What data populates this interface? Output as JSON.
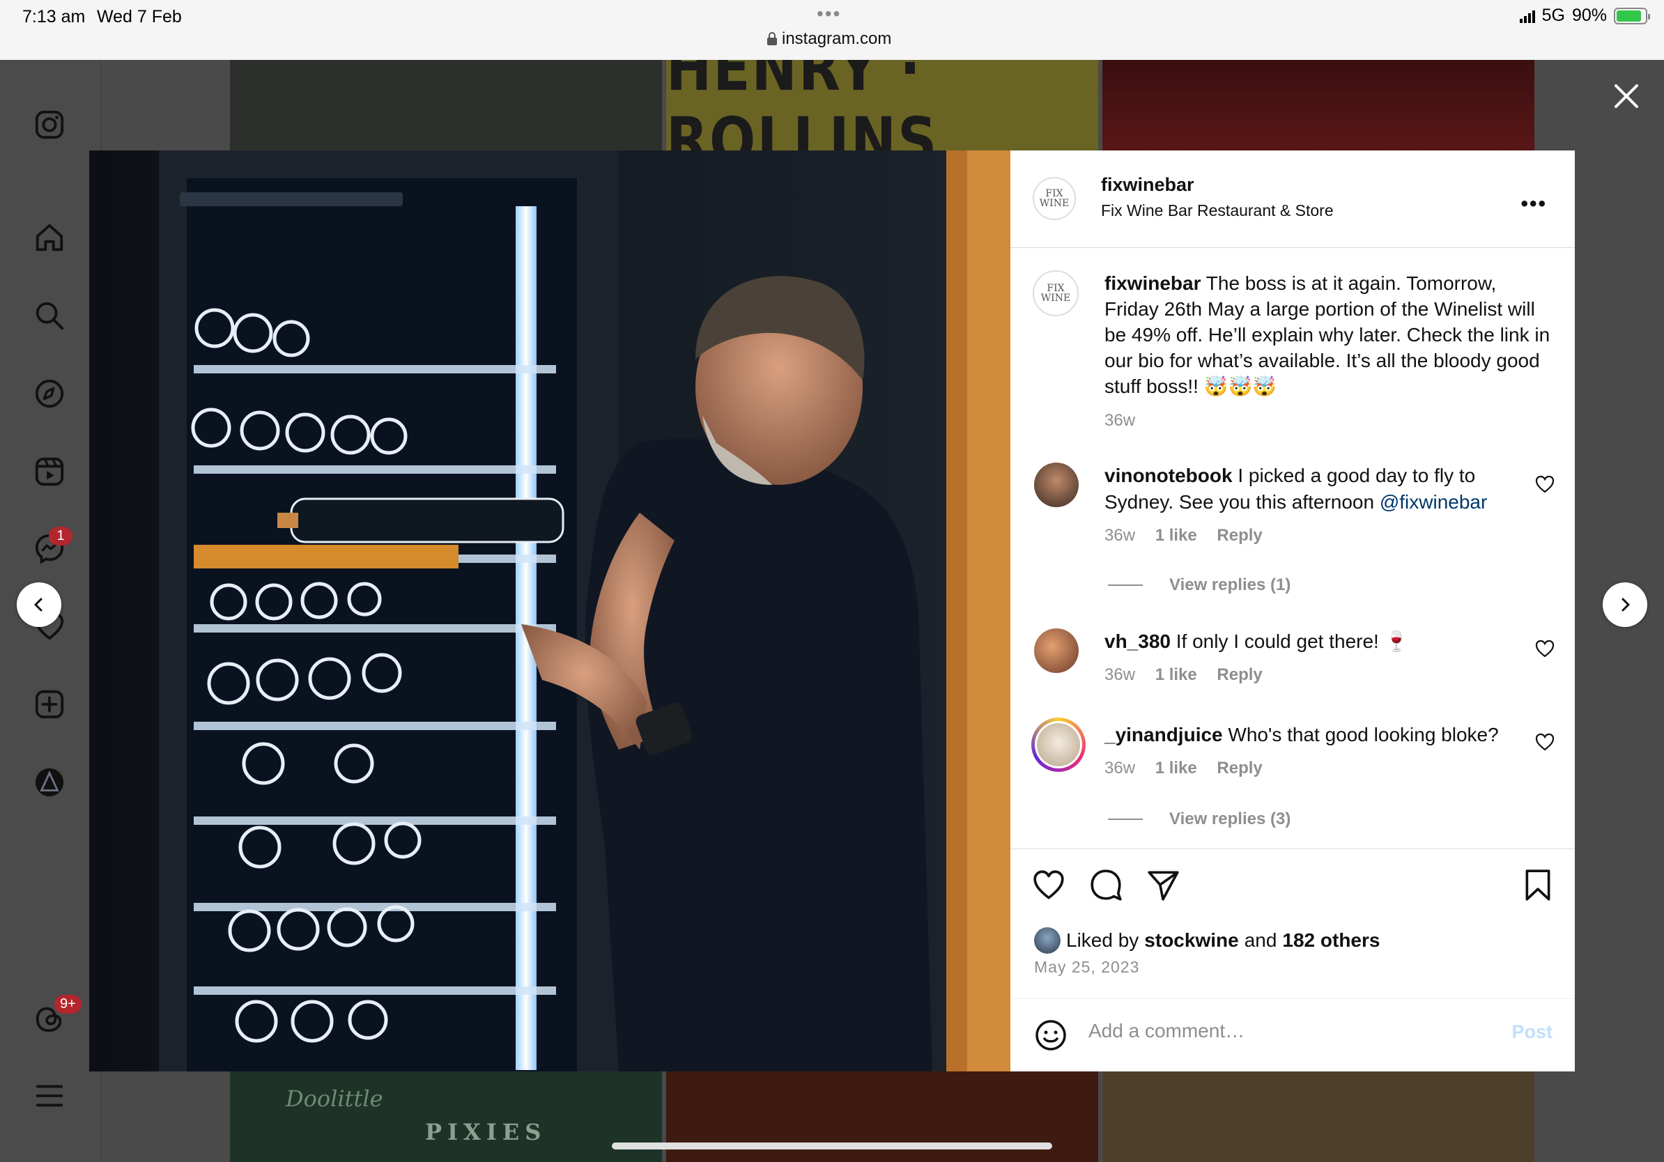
{
  "status_bar": {
    "time": "7:13 am",
    "date": "Wed 7 Feb",
    "url": "instagram.com",
    "network": "5G",
    "battery": "90%"
  },
  "sidebar": {
    "icons": [
      "instagram-logo-icon",
      "home-icon",
      "search-icon",
      "explore-icon",
      "reels-icon",
      "messenger-icon",
      "heart-icon",
      "create-icon",
      "profile-icon",
      "threads-icon",
      "menu-icon"
    ],
    "messenger_badge": "1",
    "threads_badge": "9+"
  },
  "background_tiles": {
    "henry_text": "HENRY · ROLLINS",
    "doolittle_text": "Doolittle",
    "pixies_text": "PIXIES"
  },
  "post": {
    "username": "fixwinebar",
    "location": "Fix Wine Bar Restaurant & Store",
    "avatar_text": "FIX WINE",
    "caption_user": "fixwinebar",
    "caption_text": "The boss is at it again. Tomorrow, Friday 26th May a large portion of the Winelist will be 49% off. He’ll explain why later. Check the link in our bio for what’s available. It’s all the bloody good stuff boss!! 🤯🤯🤯",
    "caption_time": "36w",
    "comments": [
      {
        "user": "vinonotebook",
        "text": "I picked a good day to fly to Sydney. See you this afternoon ",
        "mention": "@fixwinebar",
        "time": "36w",
        "likes": "1 like",
        "reply": "Reply",
        "view_replies": "View replies (1)"
      },
      {
        "user": "vh_380",
        "text": "If only I could get there! 🍷",
        "mention": "",
        "time": "36w",
        "likes": "1 like",
        "reply": "Reply",
        "view_replies": ""
      },
      {
        "user": "_yinandjuice",
        "text": "Who's that good looking bloke?",
        "mention": "",
        "time": "36w",
        "likes": "1 like",
        "reply": "Reply",
        "view_replies": "View replies (3)"
      }
    ],
    "liked_by_prefix": "Liked by",
    "liked_by_user": "stockwine",
    "liked_by_and": "and",
    "liked_by_others": "182 others",
    "date": "May 25, 2023",
    "comment_placeholder": "Add a comment…",
    "post_button": "Post"
  },
  "colors": {
    "accent": "#0095f6",
    "post_disabled": "#c0dffd",
    "badge": "#b3262d",
    "muted": "#8e8e8e"
  }
}
